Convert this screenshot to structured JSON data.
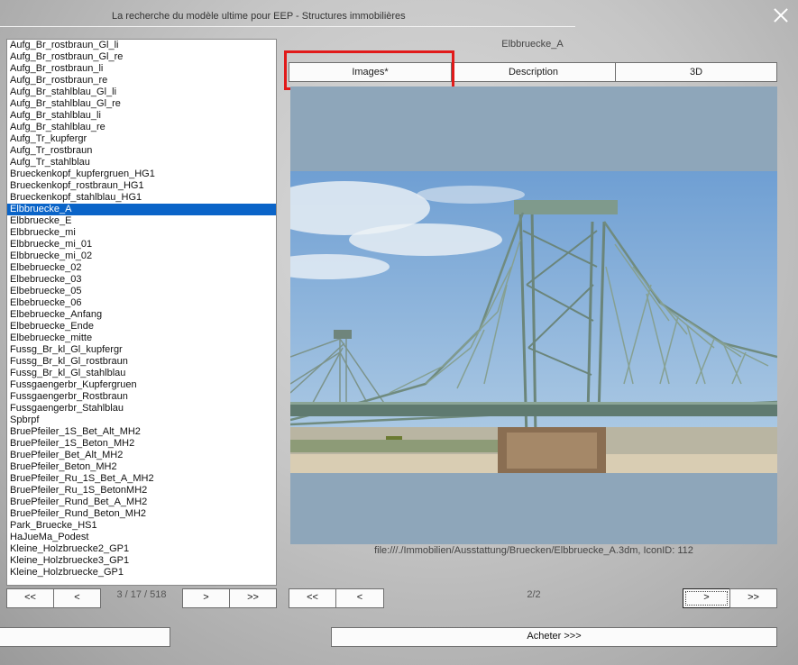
{
  "window": {
    "title": "La recherche du modèle ultime pour EEP - Structures immobilières"
  },
  "list": {
    "items": [
      "Aufg_Br_rostbraun_Gl_li",
      "Aufg_Br_rostbraun_Gl_re",
      "Aufg_Br_rostbraun_li",
      "Aufg_Br_rostbraun_re",
      "Aufg_Br_stahlblau_Gl_li",
      "Aufg_Br_stahlblau_Gl_re",
      "Aufg_Br_stahlblau_li",
      "Aufg_Br_stahlblau_re",
      "Aufg_Tr_kupfergr",
      "Aufg_Tr_rostbraun",
      "Aufg_Tr_stahlblau",
      "Brueckenkopf_kupfergruen_HG1",
      "Brueckenkopf_rostbraun_HG1",
      "Brueckenkopf_stahlblau_HG1",
      "Elbbruecke_A",
      "Elbbruecke_E",
      "Elbbruecke_mi",
      "Elbbruecke_mi_01",
      "Elbbruecke_mi_02",
      "Elbebruecke_02",
      "Elbebruecke_03",
      "Elbebruecke_05",
      "Elbebruecke_06",
      "Elbebruecke_Anfang",
      "Elbebruecke_Ende",
      "Elbebruecke_mitte",
      "Fussg_Br_kl_Gl_kupfergr",
      "Fussg_Br_kl_Gl_rostbraun",
      "Fussg_Br_kl_Gl_stahlblau",
      "Fussgaengerbr_Kupfergruen",
      "Fussgaengerbr_Rostbraun",
      "Fussgaengerbr_Stahlblau",
      "Spbrpf",
      "BruePfeiler_1S_Bet_Alt_MH2",
      "BruePfeiler_1S_Beton_MH2",
      "BruePfeiler_Bet_Alt_MH2",
      "BruePfeiler_Beton_MH2",
      "BruePfeiler_Ru_1S_Bet_A_MH2",
      "BruePfeiler_Ru_1S_BetonMH2",
      "BruePfeiler_Rund_Bet_A_MH2",
      "BruePfeiler_Rund_Beton_MH2",
      "Park_Bruecke_HS1",
      "HaJueMa_Podest",
      "Kleine_Holzbruecke2_GP1",
      "Kleine_Holzbruecke3_GP1",
      "Kleine_Holzbruecke_GP1"
    ],
    "selected_index": 14,
    "counter": "3 / 17 / 518"
  },
  "nav": {
    "first": "<<",
    "prev": "<",
    "next": ">",
    "last": ">>"
  },
  "detail": {
    "model_name": "Elbbruecke_A",
    "tabs": [
      "Images*",
      "Description",
      "3D"
    ],
    "file_path": "file:///./Immobilien/Ausstattung/Bruecken/Elbbruecke_A.3dm, IconID: 112",
    "page_indicator": "2/2"
  },
  "buy_button": "Acheter >>>",
  "colors": {
    "selection": "#0a64c8",
    "highlight": "#e11a1a",
    "bridge": "#7f9a8c",
    "sky": "#9db9d6"
  },
  "icons": {
    "close": "close-icon"
  }
}
